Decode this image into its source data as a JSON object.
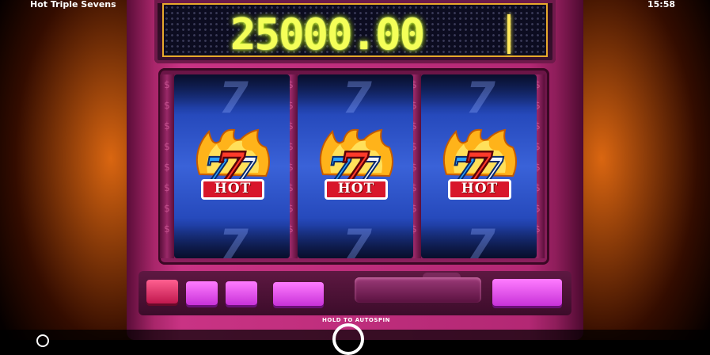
{
  "topbar": {
    "title": "Hot Triple Sevens",
    "clock": "15:58"
  },
  "display": {
    "win_amount": "25000.00"
  },
  "reels": [
    {
      "symbol": "hot-777-icon",
      "label": "HOT"
    },
    {
      "symbol": "hot-777-icon",
      "label": "HOT"
    },
    {
      "symbol": "hot-777-icon",
      "label": "HOT"
    }
  ],
  "controls": {
    "autospin_hint": "HOLD TO AUTOSPIN"
  },
  "colors": {
    "display_digits": "#f4ff58",
    "cabinet": "#c93384",
    "reel": "#2a4bc4",
    "hot_banner": "#d8162a"
  }
}
